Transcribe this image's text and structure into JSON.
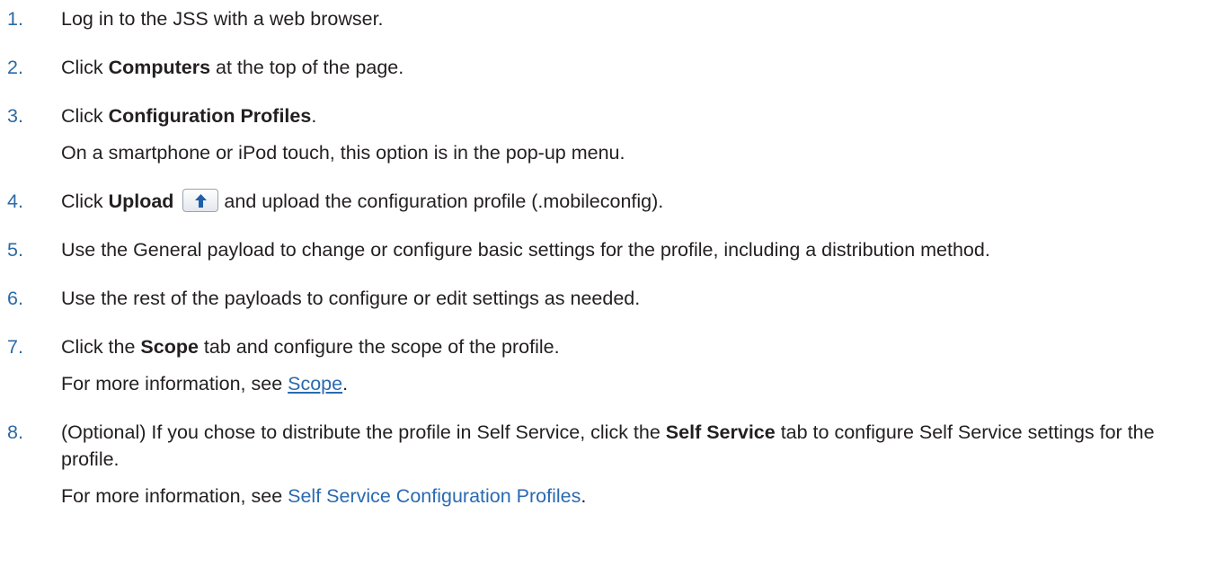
{
  "steps": [
    {
      "num": "1.",
      "text": "Log in to the JSS with a web browser."
    },
    {
      "num": "2.",
      "pre": "Click ",
      "bold": "Computers",
      "post": " at the top of the page."
    },
    {
      "num": "3.",
      "pre": "Click ",
      "bold": "Configuration Profiles",
      "post": ".",
      "note": "On a smartphone or iPod touch, this option is in the pop-up menu."
    },
    {
      "num": "4.",
      "pre": "Click ",
      "bold": "Upload",
      "post": "and upload the configuration profile (.mobileconfig).",
      "icon": "upload-arrow-icon"
    },
    {
      "num": "5.",
      "text": "Use the General payload to change or configure basic settings for the profile, including a distribution method."
    },
    {
      "num": "6.",
      "text": "Use the rest of the payloads to configure or edit settings as needed."
    },
    {
      "num": "7.",
      "pre": "Click the ",
      "bold": "Scope",
      "post": " tab and configure the scope of the profile.",
      "note_pre": "For more information, see ",
      "note_link": "Scope",
      "note_post": "."
    },
    {
      "num": "8.",
      "pre": "(Optional) If you chose to distribute the profile in Self Service, click the ",
      "bold": "Self Service",
      "post": " tab to configure Self Service settings for the profile.",
      "note_pre": "For more information, see ",
      "note_link": "Self Service Configuration Profiles",
      "note_post": "."
    }
  ],
  "colors": {
    "number": "#2c6aa5",
    "link": "#2a6ab0",
    "text": "#231f20"
  }
}
